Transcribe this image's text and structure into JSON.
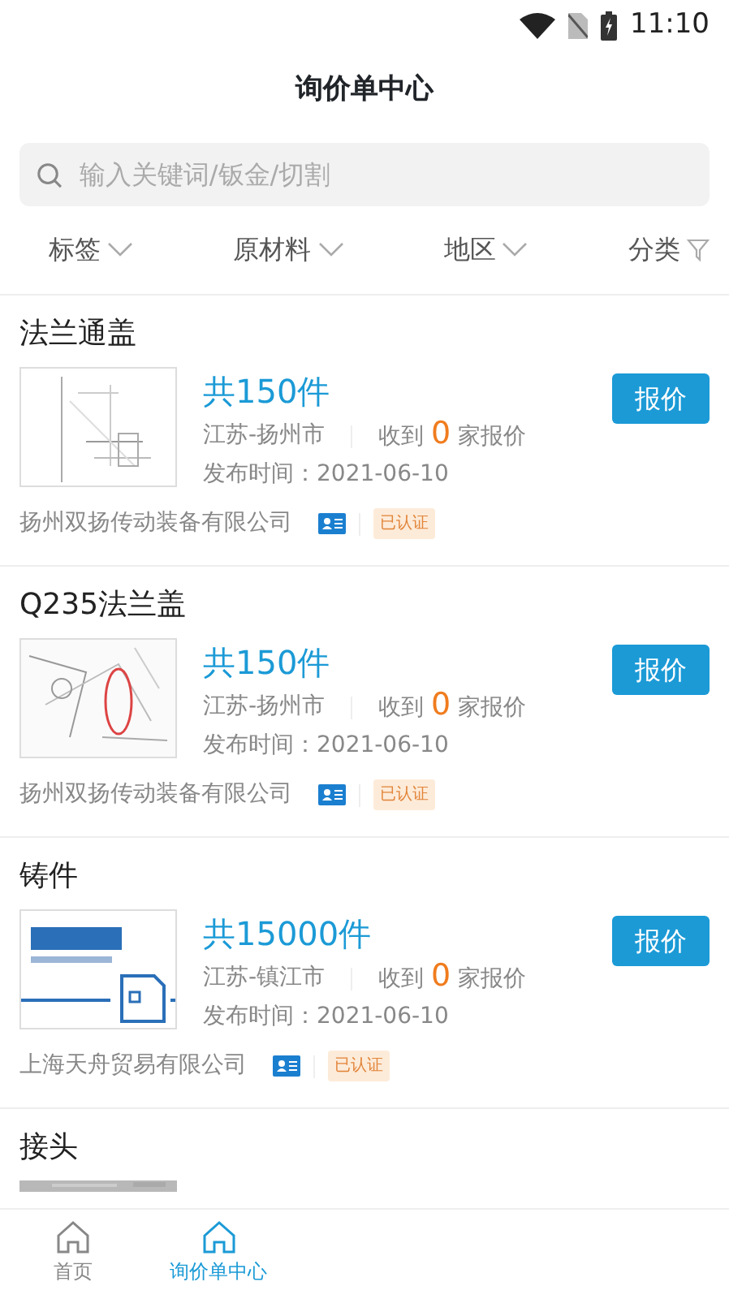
{
  "status_bar": {
    "time": "11:10"
  },
  "title": "询价单中心",
  "search": {
    "placeholder": "输入关键词/钣金/切割"
  },
  "filters": [
    {
      "label": "标签",
      "kind": "dropdown"
    },
    {
      "label": "原材料",
      "kind": "dropdown"
    },
    {
      "label": "地区",
      "kind": "dropdown"
    },
    {
      "label": "分类",
      "kind": "filter"
    }
  ],
  "items": [
    {
      "name": "法兰通盖",
      "quantity": "共150件",
      "region": "江苏-扬州市",
      "quotes_prefix": "收到",
      "quotes_count": "0",
      "quotes_suffix": "家报价",
      "date": "发布时间：2021-06-10",
      "company": "扬州双扬传动装备有限公司",
      "badge": "已认证",
      "button": "报价",
      "thumbnail": {
        "kind": "drawing"
      }
    },
    {
      "name": "Q235法兰盖",
      "quantity": "共150件",
      "region": "江苏-扬州市",
      "quotes_prefix": "收到",
      "quotes_count": "0",
      "quotes_suffix": "家报价",
      "date": "发布时间：2021-06-10",
      "company": "扬州双扬传动装备有限公司",
      "badge": "已认证",
      "button": "报价",
      "thumbnail": {
        "kind": "sketch"
      }
    },
    {
      "name": "铸件",
      "quantity": "共15000件",
      "region": "江苏-镇江市",
      "quotes_prefix": "收到",
      "quotes_count": "0",
      "quotes_suffix": "家报价",
      "date": "发布时间：2021-06-10",
      "company": "上海天舟贸易有限公司",
      "badge": "已认证",
      "button": "报价",
      "thumbnail": {
        "kind": "logo"
      }
    },
    {
      "name": "接头",
      "thumbnail": {
        "kind": "cut"
      }
    }
  ],
  "tabbar": [
    {
      "label": "首页",
      "selected": false
    },
    {
      "label": "询价单中心",
      "selected": true
    }
  ]
}
